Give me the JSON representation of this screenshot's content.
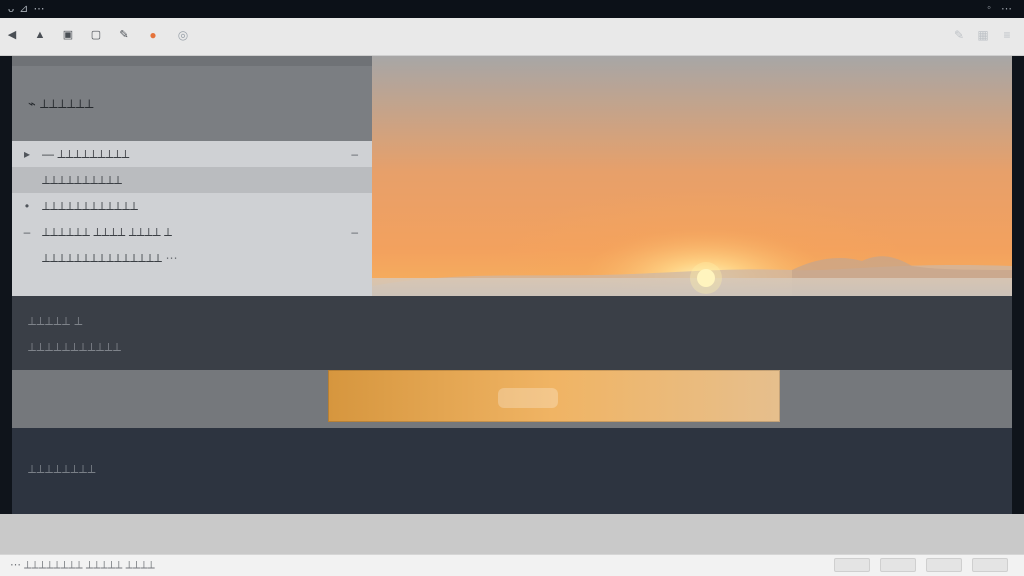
{
  "topbar": {
    "title": "ᴗ ⊿ ⋯",
    "right_icons": [
      "status-icon",
      "more-icon"
    ]
  },
  "toolbar": {
    "left_tools": [
      {
        "name": "back-icon",
        "glyph": "◀"
      },
      {
        "name": "lock-icon",
        "glyph": "🔒"
      },
      {
        "name": "doc-icon",
        "glyph": "▣"
      },
      {
        "name": "page-icon",
        "glyph": "▢"
      },
      {
        "name": "edit-icon",
        "glyph": "✎"
      },
      {
        "name": "color-swatches-icon",
        "glyph": "●"
      },
      {
        "name": "zoom-icon",
        "glyph": "◎"
      }
    ],
    "right_tools": [
      {
        "name": "pen-icon",
        "glyph": "✎"
      },
      {
        "name": "grid-icon",
        "glyph": "▦"
      },
      {
        "name": "menu-icon",
        "glyph": "≡"
      }
    ]
  },
  "panel": {
    "title": "⌁ ⟂⟂⟂⟂⟂⟂",
    "rows": [
      {
        "chevron": "▸",
        "label": "— ⟂⟂⟂⟂⟂⟂⟂⟂⟂",
        "right": "‒",
        "selected": false
      },
      {
        "chevron": "",
        "label": "⟂⟂⟂⟂⟂⟂⟂⟂⟂⟂",
        "right": "",
        "selected": true
      },
      {
        "chevron": "•",
        "label": "⟂⟂⟂⟂⟂⟂⟂⟂⟂⟂⟂⟂",
        "right": "",
        "selected": false
      },
      {
        "chevron": "‒",
        "label": "⟂⟂⟂⟂⟂⟂ ⟂⟂⟂⟂ ⟂⟂⟂⟂ ⟂",
        "right": "‒",
        "selected": false
      },
      {
        "chevron": "",
        "label": "⟂⟂⟂⟂⟂⟂⟂⟂⟂⟂⟂⟂⟂⟂⟂ ⋯",
        "right": "",
        "selected": false
      }
    ]
  },
  "bands": {
    "band1_line1": "⟂⟂⟂⟂⟂ ⟂",
    "band1_line2": "⟂⟂⟂⟂⟂⟂⟂⟂⟂⟂⟂",
    "band3_label": "⟂⟂⟂⟂⟂⟂⟂⟂"
  },
  "status": {
    "left": "⋯ ⟂⟂⟂⟂⟂⟂⟂⟂ ⟂⟂⟂⟂⟂ ⟂⟂⟂⟂",
    "right_chips": 4
  },
  "colors": {
    "sunset_top": "#a7a6a6",
    "sunset_mid": "#f3a15e",
    "sunset_low": "#f7b85e",
    "sun": "#fff4b8"
  }
}
